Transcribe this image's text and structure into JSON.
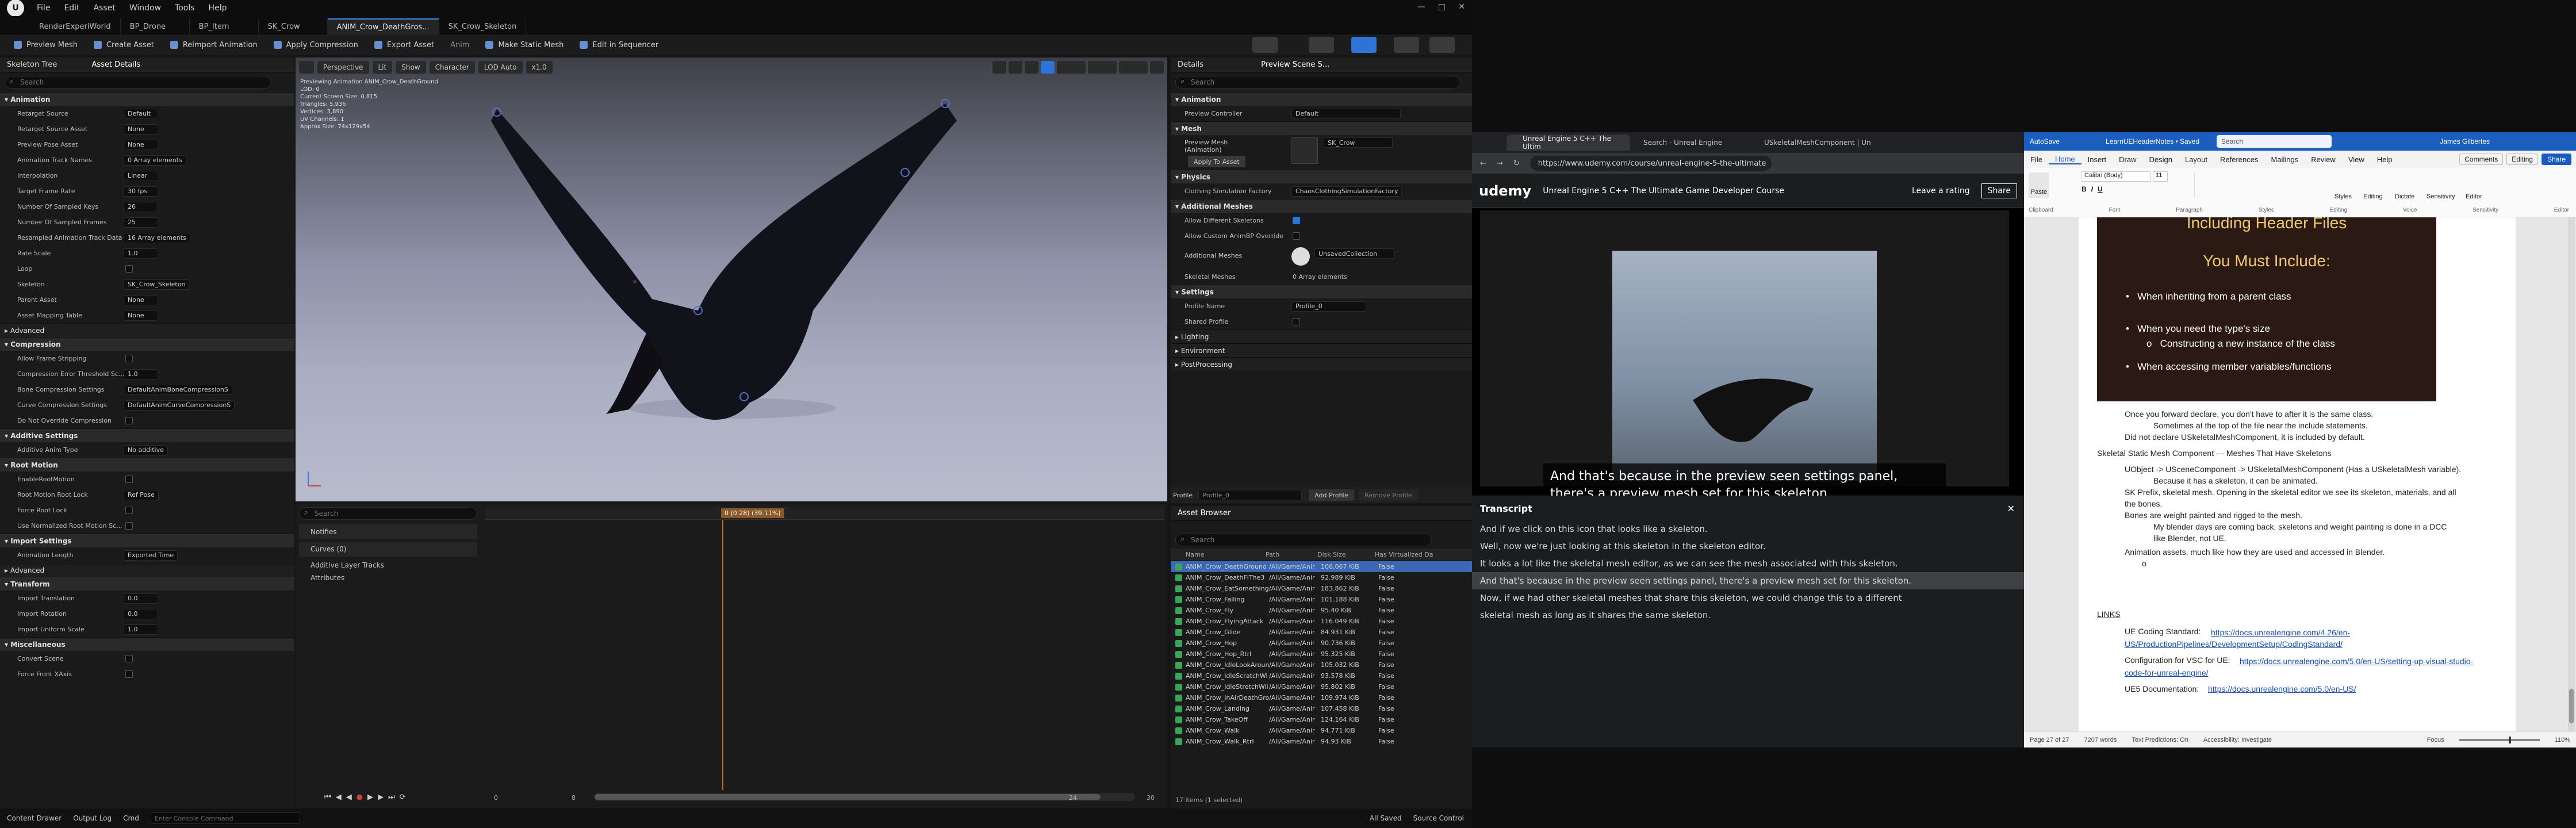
{
  "ue": {
    "menu": [
      "File",
      "Edit",
      "Asset",
      "Window",
      "Tools",
      "Help"
    ],
    "tabs": [
      "RenderExperiWorld",
      "BP_Drone",
      "BP_Item",
      "SK_Crow",
      "ANIM_Crow_DeathGros...",
      "SK_Crow_Skeleton"
    ],
    "toolbar": [
      "Preview Mesh",
      "Create Asset",
      "Reimport Animation",
      "Apply Compression",
      "Export Asset",
      "Anim",
      "Make Static Mesh",
      "Edit in Sequencer"
    ],
    "left_tabs": [
      "Skeleton Tree",
      "Asset Details"
    ],
    "search_placeholder": "Search",
    "sections": {
      "animation": "Animation",
      "advanced": "Advanced",
      "compression": "Compression",
      "additive": "Additive Settings",
      "root_motion": "Root Motion",
      "import": "Import Settings",
      "advanced2": "Advanced",
      "transform": "Transform",
      "misc": "Miscellaneous"
    },
    "anim_props": [
      {
        "label": "Retarget Source",
        "value": "Default"
      },
      {
        "label": "Retarget Source Asset",
        "value": "None"
      },
      {
        "label": "Preview Pose Asset",
        "value": "None"
      },
      {
        "label": "Animation Track Names",
        "value": "0 Array elements"
      },
      {
        "label": "Interpolation",
        "value": "Linear"
      },
      {
        "label": "Target Frame Rate",
        "value": "30 fps"
      },
      {
        "label": "Number Of Sampled Keys",
        "value": "26"
      },
      {
        "label": "Number Of Sampled Frames",
        "value": "25"
      },
      {
        "label": "Resampled Animation Track Data",
        "value": "16 Array elements"
      },
      {
        "label": "Rate Scale",
        "value": "1.0"
      },
      {
        "label": "Loop",
        "value": ""
      },
      {
        "label": "Skeleton",
        "value": "SK_Crow_Skeleton"
      },
      {
        "label": "Parent Asset",
        "value": "None"
      },
      {
        "label": "Asset Mapping Table",
        "value": "None"
      }
    ],
    "compression_props": [
      {
        "label": "Allow Frame Stripping",
        "value": ""
      },
      {
        "label": "Compression Error Threshold Sc...",
        "value": "1.0"
      },
      {
        "label": "Bone Compression Settings",
        "value": "DefaultAnimBoneCompressionS"
      },
      {
        "label": "Curve Compression Settings",
        "value": "DefaultAnimCurveCompressionS"
      },
      {
        "label": "Do Not Override Compression",
        "value": ""
      }
    ],
    "additive_props": [
      {
        "label": "Additive Anim Type",
        "value": "No additive"
      }
    ],
    "root_props": [
      {
        "label": "EnableRootMotion",
        "value": ""
      },
      {
        "label": "Root Motion Root Lock",
        "value": "Ref Pose"
      },
      {
        "label": "Force Root Lock",
        "value": ""
      },
      {
        "label": "Use Normalized Root Motion Sc...",
        "value": ""
      }
    ],
    "import_props": [
      {
        "label": "Animation Length",
        "value": "Exported Time"
      }
    ],
    "transform_props": [
      {
        "label": "Import Translation",
        "value": "0.0"
      },
      {
        "label": "Import Rotation",
        "value": "0.0"
      },
      {
        "label": "Import Uniform Scale",
        "value": "1.0"
      }
    ],
    "misc_props": [
      {
        "label": "Convert Scene",
        "value": ""
      },
      {
        "label": "Force Front XAxis",
        "value": ""
      }
    ],
    "viewport": {
      "buttons": [
        "Perspective",
        "Lit",
        "Show",
        "Character",
        "LOD Auto",
        "x1.0"
      ],
      "info": [
        "Previewing Animation ANIM_Crow_DeathGround",
        "LOD: 0",
        "Current Screen Size: 0.815",
        "Triangles: 5,936",
        "Vertices: 3,890",
        "UV Channels: 1",
        "Approx Size: 74x129x54"
      ]
    },
    "timeline": {
      "tracks": [
        "Notifies",
        "Curves (0)",
        "Additive Layer Tracks",
        "Attributes"
      ],
      "time": "0 (0.28) (39.11%)",
      "start": "0",
      "end": "24",
      "current": "8",
      "right": "30"
    },
    "details": {
      "tabs": [
        "Details",
        "Preview Scene S..."
      ],
      "sections": [
        "Animation",
        "Mesh",
        "Physics",
        "Additional Meshes",
        "Settings",
        "Lighting",
        "Environment",
        "PostProcessing"
      ],
      "preview_controller_label": "Preview Controller",
      "preview_controller": "Default",
      "preview_mesh_label": "Preview Mesh (Animation)",
      "preview_mesh": "SK_Crow",
      "apply_to_asset": "Apply To Asset",
      "clothing_label": "Clothing Simulation Factory",
      "clothing": "ChaosClothingSimulationFactory",
      "allow_skeletons": "Allow Different Skeletons",
      "allow_custom": "Allow Custom AnimBP Override",
      "additional_meshes_label": "Additional Meshes",
      "additional_meshes": "UnsavedCollection",
      "skeletal_meshes_label": "Skeletal Meshes",
      "skeletal_meshes": "0 Array elements",
      "profile_name_label": "Profile Name",
      "profile_name": "Profile_0",
      "shared_profile": "Shared Profile",
      "profile_label": "Profile",
      "profile_value": "Profile_0",
      "add_profile": "Add Profile",
      "remove_profile": "Remove Profile"
    },
    "asset_browser": {
      "title": "Asset Browser",
      "columns": [
        "Name",
        "Path",
        "Disk Size",
        "Has Virtualized Da"
      ],
      "rows": [
        [
          "ANIM_Crow_DeathGround",
          "/All/Game/Anir",
          "106.067 KiB",
          "False"
        ],
        [
          "ANIM_Crow_DeathFlThe3",
          "/All/Game/Anir",
          "92.989 KiB",
          "False"
        ],
        [
          "ANIM_Crow_EatSomething",
          "/All/Game/Anir",
          "183.862 KiB",
          "False"
        ],
        [
          "ANIM_Crow_Falling",
          "/All/Game/Anir",
          "101.188 KiB",
          "False"
        ],
        [
          "ANIM_Crow_Fly",
          "/All/Game/Anir",
          "95.40 KiB",
          "False"
        ],
        [
          "ANIM_Crow_FlyingAttack",
          "/All/Game/Anir",
          "116.049 KiB",
          "False"
        ],
        [
          "ANIM_Crow_Glide",
          "/All/Game/Anir",
          "84.931 KiB",
          "False"
        ],
        [
          "ANIM_Crow_Hop",
          "/All/Game/Anir",
          "90.736 KiB",
          "False"
        ],
        [
          "ANIM_Crow_Hop_Rtrl",
          "/All/Game/Anir",
          "95.325 KiB",
          "False"
        ],
        [
          "ANIM_Crow_IdleLookAround",
          "/All/Game/Anir",
          "105.032 KiB",
          "False"
        ],
        [
          "ANIM_Crow_IdleScratchWi",
          "/All/Game/Anir",
          "93.578 KiB",
          "False"
        ],
        [
          "ANIM_Crow_IdleStretchWii",
          "/All/Game/Anir",
          "95.802 KiB",
          "False"
        ],
        [
          "ANIM_Crow_InAirDeathGro",
          "/All/Game/Anir",
          "109.974 KiB",
          "False"
        ],
        [
          "ANIM_Crow_Landing",
          "/All/Game/Anir",
          "107.458 KiB",
          "False"
        ],
        [
          "ANIM_Crow_TakeOff",
          "/All/Game/Anir",
          "124.164 KiB",
          "False"
        ],
        [
          "ANIM_Crow_Walk",
          "/All/Game/Anir",
          "94.771 KiB",
          "False"
        ],
        [
          "ANIM_Crow_Walk_Rtrl",
          "/All/Game/Anir",
          "94.93 KiB",
          "False"
        ]
      ],
      "count": "17 items (1 selected)"
    },
    "statusbar": {
      "content_drawer": "Content Drawer",
      "output_log": "Output Log",
      "cmd": "Cmd",
      "console_placeholder": "Enter Console Command",
      "all_saved": "All Saved",
      "source_control": "Source Control"
    }
  },
  "chrome": {
    "tabs": [
      "Unreal Engine 5 C++ The Ultim",
      "Search - Unreal Engine",
      "USkeletalMeshComponent | Un"
    ],
    "url": "https://www.udemy.com/course/unreal-engine-5-the-ultimate",
    "udemy": "udemy",
    "course_title": "Unreal Engine 5 C++ The Ultimate Game Developer Course",
    "leave_rating": "Leave a rating",
    "share": "Share",
    "caption": "And that's because in the preview seen settings panel, there's a preview mesh set for this skeleton.",
    "transcript_title": "Transcript",
    "transcript": [
      "And if we click on this icon that looks like a skeleton.",
      "Well, now we're just looking at this skeleton in the skeleton editor.",
      "It looks a lot like the skeletal mesh editor, as we can see the mesh associated with this skeleton.",
      "And that's because in the preview seen settings panel, there's a preview mesh set for this skeleton.",
      "Now, if we had other skeletal meshes that share this skeleton, we could change this to a different",
      "skeletal mesh as long as it shares the same skeleton."
    ]
  },
  "word": {
    "autosave": "AutoSave",
    "filename": "LearnUEHeaderNotes • Saved",
    "search_placeholder": "Search",
    "user": "James Gilbertes",
    "tabs": [
      "File",
      "Home",
      "Insert",
      "Draw",
      "Design",
      "Layout",
      "References",
      "Mailings",
      "Review",
      "View",
      "Help"
    ],
    "comments": "Comments",
    "editing": "Editing",
    "share": "Share",
    "font": "Calibri (Body)",
    "font_size": "11",
    "groups": [
      "Clipboard",
      "Font",
      "Paragraph",
      "Styles",
      "Editing",
      "Voice",
      "Sensitivity",
      "Editor"
    ],
    "group_buttons": [
      "Paste",
      "Styles",
      "Editing",
      "Dictate",
      "Sensitivity",
      "Editor"
    ],
    "slide_title": "Including Header Files",
    "slide_subtitle": "You Must Include:",
    "slide_bullets": [
      "When inheriting from a parent class",
      "When you need the type's size",
      "Constructing a new instance of the class",
      "When accessing member variables/functions"
    ],
    "notes": [
      "Once you forward declare, you don't have to after it is the same class.",
      "Sometimes at the top of the file near the include statements.",
      "Did not declare USkeletalMeshComponent, it is included by default.",
      "Skeletal Static Mesh Component — Meshes That Have Skeletons",
      "UObject -> USceneComponent -> USkeletalMeshComponent (Has a USkeletalMesh variable).",
      "Because it has a skeleton, it can be animated.",
      "SK Prefix, skeletal mesh. Opening in the skeletal editor we see its skeleton, materials, and all",
      "the bones.",
      "Bones are weight painted and rigged to the mesh.",
      "My blender days are coming back, skeletons and weight painting is done in a DCC",
      "like Blender, not UE.",
      "Animation assets, much like how they are used and accessed in Blender.",
      "o"
    ],
    "links_heading": "LINKS",
    "links": [
      {
        "label": "UE Coding Standard:",
        "url": "https://docs.unrealengine.com/4.26/en-US/ProductionPipelines/DevelopmentSetup/CodingStandard/"
      },
      {
        "label": "Configuration for VSC for UE:",
        "url": "https://docs.unrealengine.com/5.0/en-US/setting-up-visual-studio-code-for-unreal-engine/"
      },
      {
        "label": "UE5 Documentation:",
        "url": "https://docs.unrealengine.com/5.0/en-US/"
      }
    ],
    "status": {
      "page": "Page 27 of 27",
      "words": "7207 words",
      "predictions": "Text Predictions: On",
      "accessibility": "Accessibility: Investigate",
      "focus": "Focus",
      "zoom": "110%"
    }
  },
  "colors": {
    "accent": "#2d73d8",
    "selected": "#3b67b3",
    "udemy_purple": "#a435f0",
    "word_blue": "#185abd"
  }
}
